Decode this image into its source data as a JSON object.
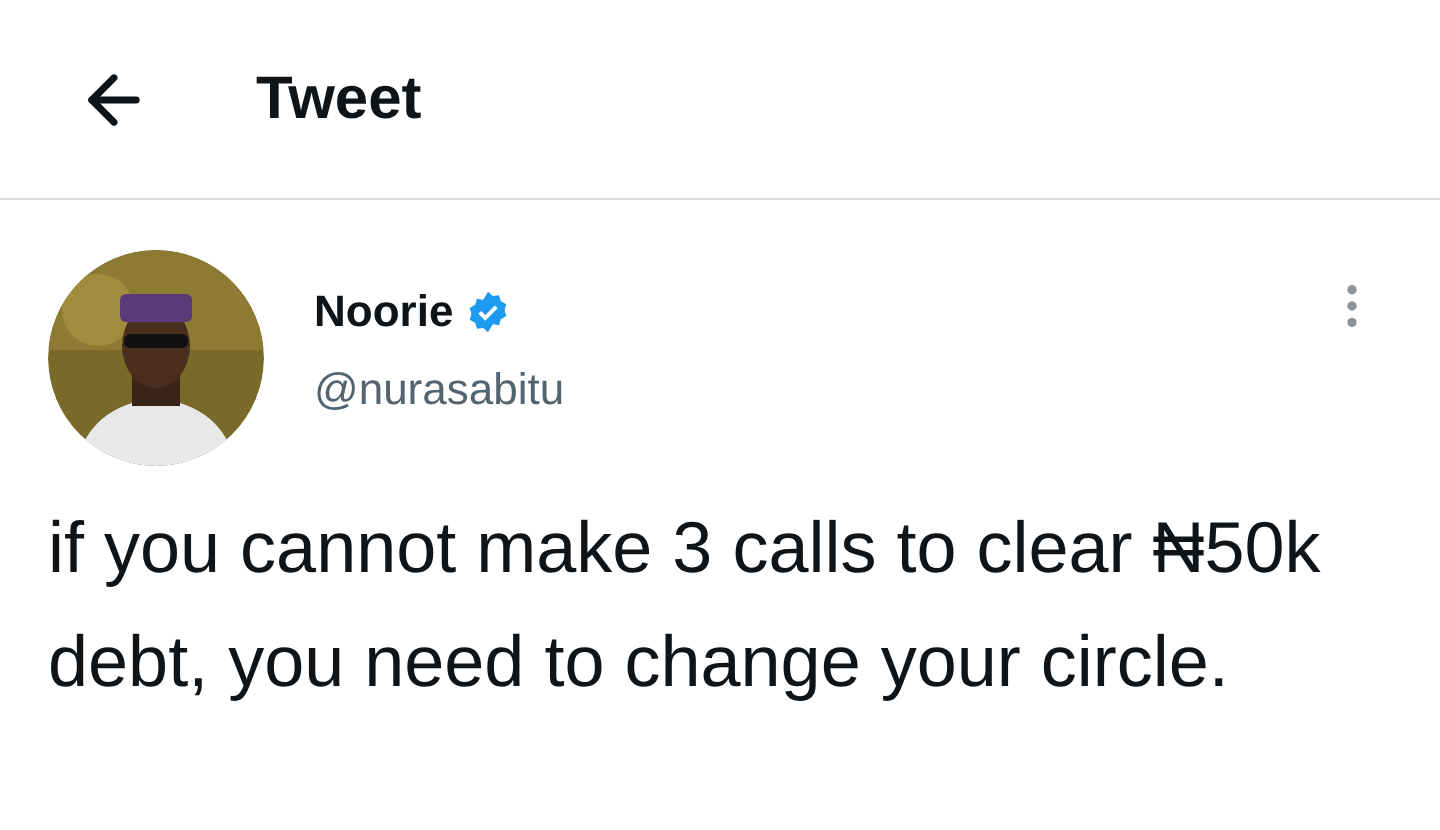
{
  "header": {
    "title": "Tweet"
  },
  "tweet": {
    "author": {
      "name": "Noorie",
      "verified": true,
      "handle": "@nurasabitu"
    },
    "text": "if you cannot make 3 calls to clear ₦50k debt, you need to change your circle."
  }
}
